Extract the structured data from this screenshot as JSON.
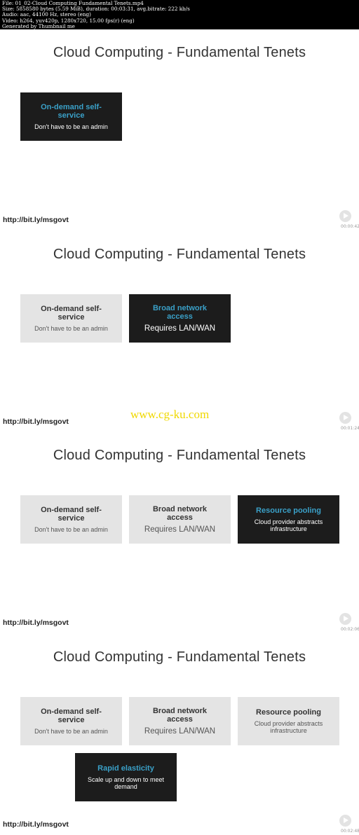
{
  "header": {
    "lines": [
      "File: 01_02-Cloud Computing  Fundamental Tenets.mp4",
      "Size: 5858580 bytes (5.59 MiB), duration: 00:03:31, avg.bitrate: 222 kb/s",
      "Audio: aac, 44100 Hz, stereo (eng)",
      "Video: h264, yuv420p, 1280x720, 15.00 fps(r) (eng)",
      "Generated by Thumbnail me"
    ]
  },
  "title": "Cloud Computing - Fundamental Tenets",
  "url": "http://bit.ly/msgovt",
  "watermark": "www.cg-ku.com",
  "tenets": [
    {
      "heading": "On-demand self-service",
      "sub": "Don't have to be an admin"
    },
    {
      "heading": "Broad network access",
      "sub": "Requires LAN/WAN"
    },
    {
      "heading": "Resource pooling",
      "sub": "Cloud provider abstracts infrastructure"
    },
    {
      "heading": "Rapid elasticity",
      "sub": "Scale up and down to meet demand"
    }
  ],
  "frames": [
    {
      "timestamp": "00:00:42"
    },
    {
      "timestamp": "00:01:24"
    },
    {
      "timestamp": "00:02:06"
    },
    {
      "timestamp": "00:02:48"
    }
  ],
  "colors": {
    "accent": "#3aa0c8",
    "dark_box": "#1c1c1c",
    "light_box": "#e4e4e4",
    "watermark": "#f0d800"
  }
}
